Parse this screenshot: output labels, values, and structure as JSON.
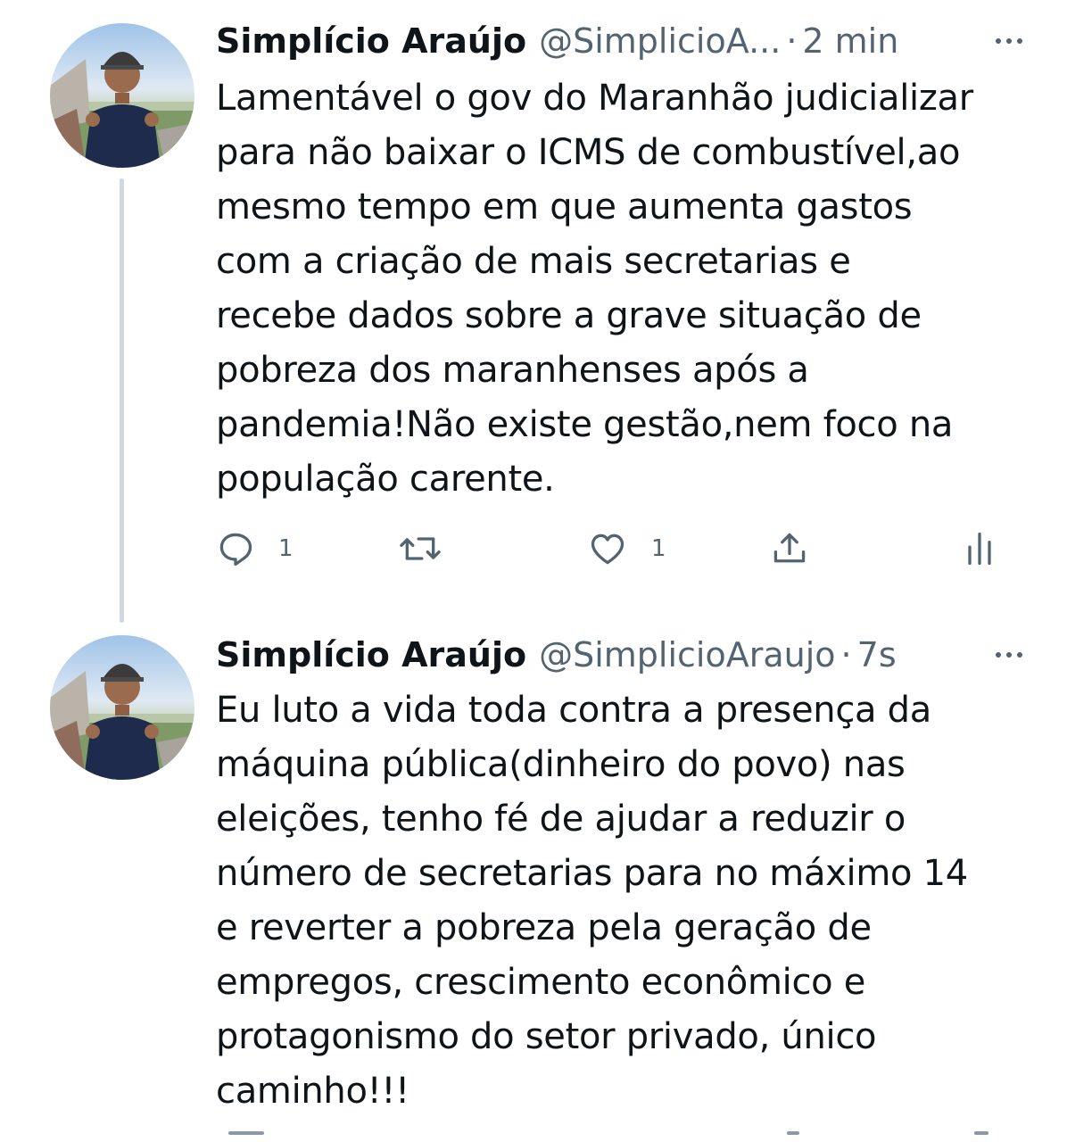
{
  "tweets": [
    {
      "name": "Simplício Araújo",
      "handle": "@SimplicioA...",
      "separator": "·",
      "time": "2 min",
      "text": "Lamentável o gov do Maranhão judicializar\npara não baixar o ICMS de combustível,ao\nmesmo tempo em que aumenta gastos\ncom a criação de mais secretarias e\nrecebe dados sobre a grave situação de\npobreza dos maranhenses após a\npandemia!Não existe gestão,nem foco na\npopulação carente.",
      "actions": {
        "reply_icon": "reply-icon",
        "reply_count": "1",
        "retweet_icon": "retweet-icon",
        "like_icon": "heart-icon",
        "like_count": "1",
        "share_icon": "share-icon",
        "stats_icon": "analytics-icon"
      }
    },
    {
      "name": "Simplício Araújo",
      "handle": "@SimplicioAraujo",
      "separator": "·",
      "time": "7s",
      "text": "Eu luto a vida toda contra a presença da\nmáquina pública(dinheiro do povo) nas\neleições, tenho fé de ajudar a reduzir o\nnúmero de secretarias para no máximo 14\ne reverter a pobreza pela geração de\nempregos, crescimento econômico e\nprotagonismo do setor privado, único\ncaminho!!!"
    }
  ],
  "colors": {
    "text": "#0f1419",
    "secondary": "#536471",
    "thread_line": "#cfd9de"
  }
}
